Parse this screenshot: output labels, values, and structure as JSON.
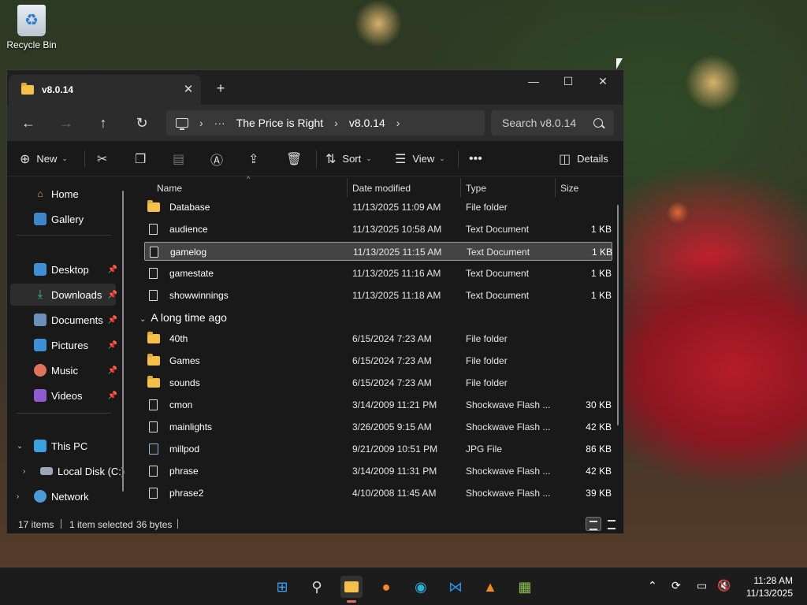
{
  "desktop": {
    "recycle_bin_label": "Recycle Bin"
  },
  "window": {
    "tab_title": "v8.0.14",
    "tab_close": "✕",
    "new_tab": "+",
    "minimize": "—",
    "maximize": "☐",
    "close": "✕"
  },
  "address": {
    "back": "←",
    "forward": "→",
    "up": "↑",
    "refresh": "↻",
    "more": "···",
    "breadcrumbs": [
      "The Price is Right",
      "v8.0.14"
    ],
    "sep": "›",
    "search_placeholder": "Search v8.0.14"
  },
  "toolbar": {
    "new_label": "New",
    "sort_label": "Sort",
    "view_label": "View",
    "more": "•••",
    "details_label": "Details"
  },
  "sidebar": {
    "items": [
      {
        "label": "Home",
        "icon": "home-icon"
      },
      {
        "label": "Gallery",
        "icon": "gallery-icon"
      },
      {
        "label": "Desktop",
        "icon": "desktop-icon",
        "pinned": true
      },
      {
        "label": "Downloads",
        "icon": "downloads-icon",
        "pinned": true
      },
      {
        "label": "Documents",
        "icon": "documents-icon",
        "pinned": true
      },
      {
        "label": "Pictures",
        "icon": "pictures-icon",
        "pinned": true
      },
      {
        "label": "Music",
        "icon": "music-icon",
        "pinned": true
      },
      {
        "label": "Videos",
        "icon": "videos-icon",
        "pinned": true
      },
      {
        "label": "This PC",
        "icon": "pc-icon"
      },
      {
        "label": "Local Disk (C:)",
        "icon": "drive-icon"
      },
      {
        "label": "Network",
        "icon": "network-icon"
      }
    ]
  },
  "columns": {
    "name": "Name",
    "date": "Date modified",
    "type": "Type",
    "size": "Size"
  },
  "files_recent": [
    {
      "name": "Database",
      "date": "11/13/2025 11:09 AM",
      "type": "File folder",
      "size": "",
      "icon": "folder-icon"
    },
    {
      "name": "audience",
      "date": "11/13/2025 10:58 AM",
      "type": "Text Document",
      "size": "1 KB",
      "icon": "document-icon"
    },
    {
      "name": "gamelog",
      "date": "11/13/2025 11:15 AM",
      "type": "Text Document",
      "size": "1 KB",
      "icon": "document-icon",
      "selected": true
    },
    {
      "name": "gamestate",
      "date": "11/13/2025 11:16 AM",
      "type": "Text Document",
      "size": "1 KB",
      "icon": "document-icon"
    },
    {
      "name": "showwinnings",
      "date": "11/13/2025 11:18 AM",
      "type": "Text Document",
      "size": "1 KB",
      "icon": "document-icon"
    }
  ],
  "group_label": "A long time ago",
  "files_old": [
    {
      "name": "40th",
      "date": "6/15/2024 7:23 AM",
      "type": "File folder",
      "size": "",
      "icon": "folder-icon"
    },
    {
      "name": "Games",
      "date": "6/15/2024 7:23 AM",
      "type": "File folder",
      "size": "",
      "icon": "folder-icon"
    },
    {
      "name": "sounds",
      "date": "6/15/2024 7:23 AM",
      "type": "File folder",
      "size": "",
      "icon": "folder-icon"
    },
    {
      "name": "cmon",
      "date": "3/14/2009 11:21 PM",
      "type": "Shockwave Flash ...",
      "size": "30 KB",
      "icon": "document-icon"
    },
    {
      "name": "mainlights",
      "date": "3/26/2005 9:15 AM",
      "type": "Shockwave Flash ...",
      "size": "42 KB",
      "icon": "document-icon"
    },
    {
      "name": "millpod",
      "date": "9/21/2009 10:51 PM",
      "type": "JPG File",
      "size": "86 KB",
      "icon": "image-icon"
    },
    {
      "name": "phrase",
      "date": "3/14/2009 11:31 PM",
      "type": "Shockwave Flash ...",
      "size": "42 KB",
      "icon": "document-icon"
    },
    {
      "name": "phrase2",
      "date": "4/10/2008 11:45 AM",
      "type": "Shockwave Flash ...",
      "size": "39 KB",
      "icon": "document-icon"
    }
  ],
  "status": {
    "count": "17 items",
    "selection": "1 item selected",
    "size": "36 bytes"
  },
  "taskbar": {
    "clock_time": "11:28 AM",
    "clock_date": "11/13/2025",
    "apps": [
      "start-icon",
      "search-icon",
      "file-explorer-icon",
      "firefox-icon",
      "edge-icon",
      "vscode-icon",
      "vlc-icon",
      "notepad-plus-icon"
    ]
  },
  "colors": {
    "folder": "#f4c04a",
    "window_bg": "#191919",
    "selection": "#444444"
  }
}
